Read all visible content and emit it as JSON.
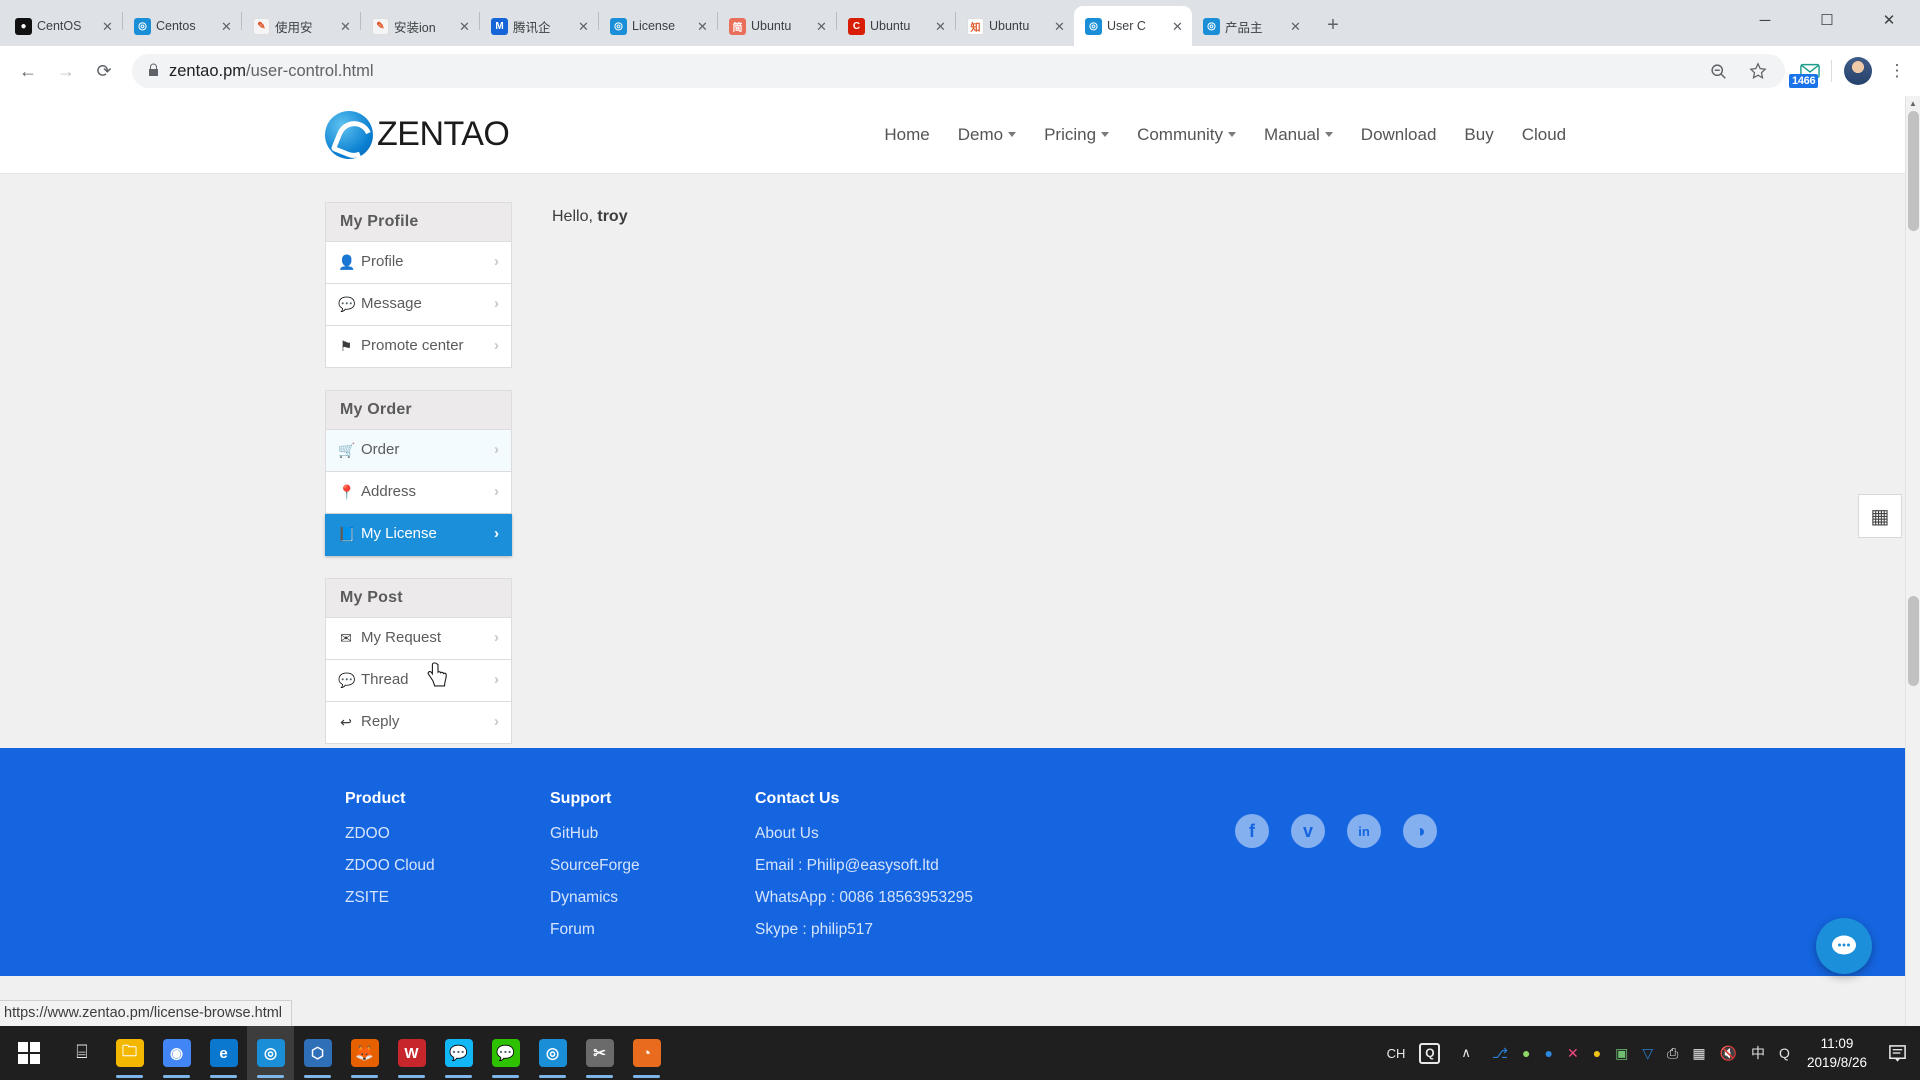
{
  "browser": {
    "tabs": [
      {
        "title": "CentOS",
        "favicon": "centos-icon",
        "color": "#111111",
        "glyph": "●"
      },
      {
        "title": "Centos",
        "favicon": "zentao-icon",
        "color": "#1a8fd8",
        "glyph": "◎"
      },
      {
        "title": "使用安",
        "favicon": "editor-icon",
        "color": "#f5f5f5",
        "glyph": "✎"
      },
      {
        "title": "安装ion",
        "favicon": "editor-icon",
        "color": "#f5f5f5",
        "glyph": "✎"
      },
      {
        "title": "腾讯企",
        "favicon": "tencent-icon",
        "color": "#1565d8",
        "glyph": "M"
      },
      {
        "title": "License",
        "favicon": "zentao-icon",
        "color": "#1a8fd8",
        "glyph": "◎"
      },
      {
        "title": "Ubuntu",
        "favicon": "jianshu-icon",
        "color": "#ea6f5a",
        "glyph": "简"
      },
      {
        "title": "Ubuntu",
        "favicon": "csdn-icon",
        "color": "#d81e06",
        "glyph": "C"
      },
      {
        "title": "Ubuntu",
        "favicon": "zhihu-icon",
        "color": "#ffffff",
        "glyph": "知"
      },
      {
        "title": "User C",
        "favicon": "zentao-icon",
        "color": "#1a8fd8",
        "glyph": "◎",
        "active": true
      },
      {
        "title": "产品主",
        "favicon": "zentao-icon",
        "color": "#1a8fd8",
        "glyph": "◎"
      }
    ],
    "new_tab_label": "+",
    "window_controls": {
      "minimize": "─",
      "maximize": "☐",
      "close": "✕"
    },
    "back_label": "←",
    "forward_label": "→",
    "reload_label": "⟳",
    "lock_label": "🔒",
    "url_domain": "zentao.pm",
    "url_path": "/user-control.html",
    "url_full": "zentao.pm/user-control.html",
    "zoom_icon": "zoom-out-icon",
    "zoom_glyph": "⊖",
    "bookmark_glyph": "☆",
    "extension_badge": "1466",
    "menu_glyph": "⋮"
  },
  "site": {
    "logo_text": "ZENTAO",
    "nav": [
      {
        "label": "Home",
        "caret": false
      },
      {
        "label": "Demo",
        "caret": true
      },
      {
        "label": "Pricing",
        "caret": true
      },
      {
        "label": "Community",
        "caret": true
      },
      {
        "label": "Manual",
        "caret": true
      },
      {
        "label": "Download",
        "caret": false
      },
      {
        "label": "Buy",
        "caret": false
      },
      {
        "label": "Cloud",
        "caret": false
      }
    ]
  },
  "sidebar": {
    "panels": [
      {
        "title": "My Profile",
        "items": [
          {
            "label": "Profile",
            "icon": "user-icon",
            "glyph": "👤",
            "state": "normal"
          },
          {
            "label": "Message",
            "icon": "comments-icon",
            "glyph": "💬",
            "state": "normal"
          },
          {
            "label": "Promote center",
            "icon": "flag-icon",
            "glyph": "⚑",
            "state": "normal"
          }
        ]
      },
      {
        "title": "My Order",
        "items": [
          {
            "label": "Order",
            "icon": "cart-icon",
            "glyph": "🛒",
            "state": "hover-soft"
          },
          {
            "label": "Address",
            "icon": "map-pin-icon",
            "glyph": "📍",
            "state": "normal"
          },
          {
            "label": "My License",
            "icon": "book-icon",
            "glyph": "📘",
            "state": "active"
          }
        ]
      },
      {
        "title": "My Post",
        "items": [
          {
            "label": "My Request",
            "icon": "envelope-icon",
            "glyph": "✉",
            "state": "normal"
          },
          {
            "label": "Thread",
            "icon": "comment-icon",
            "glyph": "💬",
            "state": "normal"
          },
          {
            "label": "Reply",
            "icon": "reply-arrow-icon",
            "glyph": "↩",
            "state": "normal"
          }
        ]
      }
    ],
    "chevron": "›"
  },
  "main": {
    "greeting_prefix": "Hello, ",
    "greeting_user": "troy"
  },
  "footer": {
    "columns": [
      {
        "heading": "Product",
        "links": [
          "ZDOO",
          "ZDOO Cloud",
          "ZSITE"
        ]
      },
      {
        "heading": "Support",
        "links": [
          "GitHub",
          "SourceForge",
          "Dynamics",
          "Forum"
        ]
      },
      {
        "heading": "Contact Us",
        "links": [
          "About Us",
          "Email : Philip@easysoft.ltd",
          "WhatsApp : 0086 18563953295",
          "Skype : philip517"
        ]
      }
    ],
    "socials": [
      {
        "name": "facebook-icon",
        "glyph": "f"
      },
      {
        "name": "twitter-icon",
        "glyph": "ᴠ"
      },
      {
        "name": "linkedin-icon",
        "glyph": "in"
      },
      {
        "name": "github-icon",
        "glyph": "◑"
      }
    ]
  },
  "widgets": {
    "qr_glyph": "▦",
    "qr_arrow": "‹",
    "chat_glyph": "💬"
  },
  "status_bar": {
    "link": "https://www.zentao.pm/license-browse.html"
  },
  "taskbar": {
    "search_glyph": "⌸",
    "apps": [
      {
        "name": "file-explorer",
        "glyph": "🗀",
        "color": "#f3b700",
        "state": "running"
      },
      {
        "name": "chrome",
        "glyph": "◉",
        "color": "#4285f4",
        "state": "running"
      },
      {
        "name": "edge",
        "glyph": "e",
        "color": "#0b78d0",
        "state": "running"
      },
      {
        "name": "zentao-browser",
        "glyph": "◎",
        "color": "#1a8fd8",
        "state": "focus"
      },
      {
        "name": "virtualbox",
        "glyph": "⬡",
        "color": "#2e6fb7",
        "state": "running"
      },
      {
        "name": "firefox",
        "glyph": "🦊",
        "color": "#e66000",
        "state": "running"
      },
      {
        "name": "wps-writer",
        "glyph": "W",
        "color": "#c7262c",
        "state": "running"
      },
      {
        "name": "qq",
        "glyph": "💬",
        "color": "#12b7f5",
        "state": "running"
      },
      {
        "name": "wechat",
        "glyph": "💬",
        "color": "#2dc100",
        "state": "running"
      },
      {
        "name": "zentao-app",
        "glyph": "◎",
        "color": "#1a8fd8",
        "state": "running"
      },
      {
        "name": "snipaste",
        "glyph": "✂",
        "color": "#6b6b6b",
        "state": "running"
      },
      {
        "name": "xmind",
        "glyph": "◔",
        "color": "#e86b1e",
        "state": "running"
      }
    ],
    "ime_label": "CH",
    "ime_badge": "Q",
    "tray_expand": "∧",
    "tray_icons": [
      {
        "name": "usb-icon",
        "glyph": "⎇",
        "color": "#2b7fd4"
      },
      {
        "name": "wechat-tray-icon",
        "glyph": "●",
        "color": "#8ed86a"
      },
      {
        "name": "qq-tray-icon",
        "glyph": "●",
        "color": "#2b8ae0"
      },
      {
        "name": "xunlei-icon",
        "glyph": "✕",
        "color": "#f4467f"
      },
      {
        "name": "penguin-icon",
        "glyph": "●",
        "color": "#f0c419"
      },
      {
        "name": "screen-lock-icon",
        "glyph": "▣",
        "color": "#6fbf73"
      },
      {
        "name": "shield-icon",
        "glyph": "▽",
        "color": "#2b7fd4"
      },
      {
        "name": "printer-icon",
        "glyph": "⎙",
        "color": "#e0e0e0"
      },
      {
        "name": "network-icon",
        "glyph": "▦",
        "color": "#e0e0e0"
      },
      {
        "name": "volume-mute-icon",
        "glyph": "🔇",
        "color": "#e0e0e0"
      },
      {
        "name": "ime-chinese-icon",
        "glyph": "中",
        "color": "#e0e0e0"
      },
      {
        "name": "sogou-icon",
        "glyph": "Q",
        "color": "#e0e0e0"
      }
    ],
    "clock_time": "11:09",
    "clock_date": "2019/8/26",
    "notification_glyph": "🖥"
  }
}
